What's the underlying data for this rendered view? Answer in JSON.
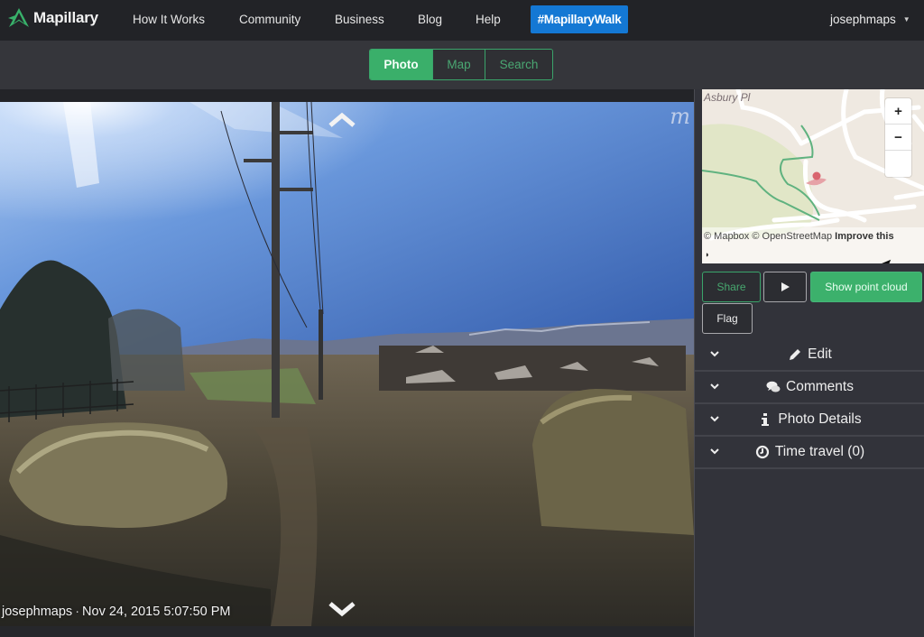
{
  "navbar": {
    "brand": "Mapillary",
    "links": [
      "How It Works",
      "Community",
      "Business",
      "Blog",
      "Help"
    ],
    "hashtag": "#MapillaryWalk",
    "user": "josephmaps"
  },
  "view_tabs": [
    {
      "label": "Photo",
      "active": true
    },
    {
      "label": "Map",
      "active": false
    },
    {
      "label": "Search",
      "active": false
    }
  ],
  "photo": {
    "watermark": "m",
    "caption_user": "josephmaps",
    "caption_separator": "·",
    "caption_datetime": "Nov 24, 2015 5:07:50 PM",
    "up_arrow_icon": "chevron-up-icon",
    "down_arrow_icon": "chevron-down-icon"
  },
  "minimap": {
    "street_label": "Asbury Pl",
    "zoom_in": "+",
    "zoom_out": "−",
    "attribution": "© Mapbox © OpenStreetMap",
    "improve_link": "Improve this",
    "colors": {
      "trail": "#5fb27f",
      "marker": "#d9656f",
      "land": "#efe9e1",
      "park": "#dfe6c4"
    }
  },
  "actions": {
    "share": "Share",
    "play_icon": "play-icon",
    "point_cloud": "Show point cloud",
    "flag": "Flag"
  },
  "accordion": [
    {
      "label": "Edit",
      "icon": "pencil-icon"
    },
    {
      "label": "Comments",
      "icon": "comments-icon"
    },
    {
      "label": "Photo Details",
      "icon": "info-icon"
    },
    {
      "label": "Time travel (0)",
      "icon": "clock-icon"
    }
  ],
  "colors": {
    "accent_green": "#3aaf6a",
    "hashtag_blue": "#1478d4",
    "navbar_bg": "#222327",
    "panel_bg": "#32333a"
  }
}
